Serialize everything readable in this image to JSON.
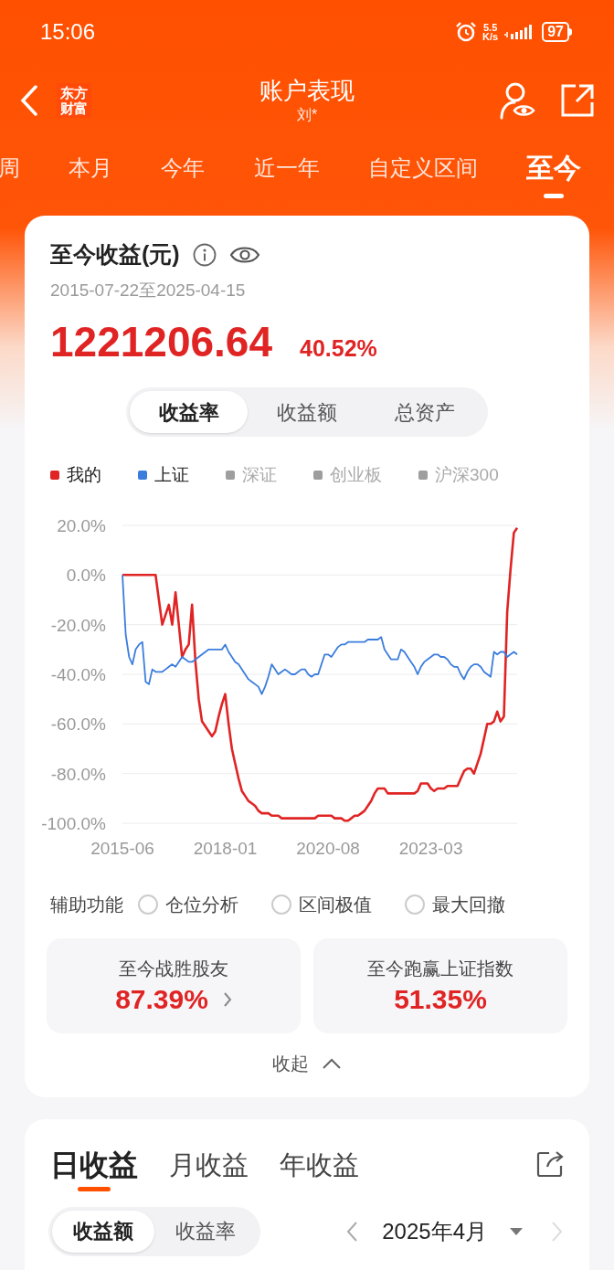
{
  "status_bar": {
    "time": "15:06",
    "net_speed": "5.5",
    "net_unit": "K/s",
    "battery": "97"
  },
  "header": {
    "logo": [
      "东方",
      "财富"
    ],
    "title": "账户表现",
    "subtitle": "刘*"
  },
  "period_tabs": [
    {
      "label": "周",
      "selected": false
    },
    {
      "label": "本月",
      "selected": false
    },
    {
      "label": "今年",
      "selected": false
    },
    {
      "label": "近一年",
      "selected": false
    },
    {
      "label": "自定义区间",
      "selected": false
    },
    {
      "label": "至今",
      "selected": true
    }
  ],
  "summary": {
    "title": "至今收益(元)",
    "date_range": "2015-07-22至2025-04-15",
    "amount": "1221206.64",
    "rate": "40.52%",
    "modes": [
      {
        "label": "收益率",
        "selected": true
      },
      {
        "label": "收益额",
        "selected": false
      },
      {
        "label": "总资产",
        "selected": false
      }
    ],
    "legend_others": [
      {
        "label": "深证",
        "selected": false
      },
      {
        "label": "创业板",
        "selected": false
      },
      {
        "label": "沪深300",
        "selected": false
      }
    ],
    "chart_data": {
      "type": "line",
      "categories": [
        "2015-06",
        null,
        null,
        null,
        null,
        null,
        null,
        null,
        null,
        null,
        null,
        null,
        null,
        null,
        null,
        null,
        null,
        null,
        null,
        null,
        null,
        null,
        null,
        null,
        null,
        null,
        null,
        null,
        null,
        null,
        null,
        "2018-01",
        null,
        null,
        null,
        null,
        null,
        null,
        null,
        null,
        null,
        null,
        null,
        null,
        null,
        null,
        null,
        null,
        null,
        null,
        null,
        null,
        null,
        null,
        null,
        null,
        null,
        null,
        null,
        null,
        null,
        null,
        "2020-08",
        null,
        null,
        null,
        null,
        null,
        null,
        null,
        null,
        null,
        null,
        null,
        null,
        null,
        null,
        null,
        null,
        null,
        null,
        null,
        null,
        null,
        null,
        null,
        null,
        null,
        null,
        null,
        null,
        null,
        null,
        "2023-03",
        null,
        null,
        null,
        null,
        null,
        null,
        null,
        null,
        null,
        null,
        null,
        null,
        null,
        null,
        null,
        null,
        null,
        null,
        null,
        null,
        null,
        null,
        null,
        null,
        null,
        null
      ],
      "grid": true,
      "series": [
        {
          "name": "我的",
          "color": "#e02424",
          "values": [
            0,
            0,
            0,
            0,
            0,
            0,
            0,
            0,
            0,
            0,
            0,
            -10,
            -20,
            -16,
            -12,
            -20,
            -7,
            -20,
            -33,
            -30,
            -28,
            -12,
            -35,
            -50,
            -59,
            -61,
            -63,
            -65,
            -63,
            -57,
            -52,
            -48,
            -60,
            -70,
            -76,
            -82,
            -87,
            -89,
            -91,
            -92,
            -93,
            -95,
            -96,
            -96,
            -96,
            -97,
            -97,
            -97,
            -98,
            -98,
            -98,
            -98,
            -98,
            -98,
            -98,
            -98,
            -98,
            -98,
            -98,
            -97,
            -97,
            -97,
            -97,
            -97,
            -98,
            -98,
            -98,
            -99,
            -99,
            -98,
            -97,
            -97,
            -96,
            -95,
            -93,
            -91,
            -88,
            -86,
            -86,
            -86,
            -88,
            -88,
            -88,
            -88,
            -88,
            -88,
            -88,
            -88,
            -88,
            -87,
            -84,
            -84,
            -84,
            -86,
            -87,
            -86,
            -86,
            -86,
            -85,
            -85,
            -85,
            -85,
            -82,
            -79,
            -78,
            -78,
            -80,
            -76,
            -72,
            -66,
            -60,
            -60,
            -59,
            -55,
            -59,
            -57,
            -15,
            2,
            17,
            19
          ]
        },
        {
          "name": "上证",
          "color": "#3b7ddd",
          "values": [
            0,
            -24,
            -33,
            -36,
            -30,
            -28,
            -27,
            -43,
            -44,
            -38,
            -39,
            -39,
            -39,
            -38,
            -37,
            -36,
            -37,
            -35,
            -33,
            -34,
            -35,
            -35,
            -34,
            -33,
            -32,
            -31,
            -30,
            -30,
            -30,
            -30,
            -30,
            -28,
            -31,
            -33,
            -35,
            -36,
            -38,
            -40,
            -42,
            -43,
            -44,
            -45,
            -48,
            -45,
            -41,
            -36,
            -38,
            -40,
            -39,
            -38,
            -39,
            -40,
            -40,
            -39,
            -38,
            -38,
            -40,
            -41,
            -40,
            -40,
            -36,
            -32,
            -32,
            -33,
            -31,
            -29,
            -28,
            -28,
            -27,
            -27,
            -27,
            -27,
            -27,
            -27,
            -26,
            -26,
            -26,
            -26,
            -25,
            -30,
            -32,
            -34,
            -34,
            -34,
            -30,
            -31,
            -33,
            -35,
            -37,
            -40,
            -37,
            -35,
            -34,
            -33,
            -32,
            -32,
            -33,
            -33,
            -34,
            -36,
            -37,
            -37,
            -40,
            -42,
            -39,
            -37,
            -36,
            -36,
            -37,
            -39,
            -40,
            -41,
            -31,
            -32,
            -31,
            -31,
            -33,
            -32,
            -31,
            -32
          ]
        }
      ],
      "ylim": [
        -100,
        20
      ],
      "yticks": [
        {
          "value": 20,
          "label": "20.0%"
        },
        {
          "value": 0,
          "label": "0.0%"
        },
        {
          "value": -20,
          "label": "-20.0%"
        },
        {
          "value": -40,
          "label": "-40.0%"
        },
        {
          "value": -60,
          "label": "-60.0%"
        },
        {
          "value": -80,
          "label": "-80.0%"
        },
        {
          "value": -100,
          "label": "-100.0%"
        }
      ]
    },
    "tools_label": "辅助功能",
    "tools": [
      {
        "label": "仓位分析",
        "checked": false
      },
      {
        "label": "区间极值",
        "checked": false
      },
      {
        "label": "最大回撤",
        "checked": false
      }
    ],
    "stats": [
      {
        "label": "至今战胜股友",
        "value": "87.39%",
        "link": true
      },
      {
        "label": "至今跑赢上证指数",
        "value": "51.35%",
        "link": false
      }
    ],
    "collapse": "收起"
  },
  "daily": {
    "tabs": [
      {
        "label": "日收益",
        "selected": true
      },
      {
        "label": "月收益",
        "selected": false
      },
      {
        "label": "年收益",
        "selected": false
      }
    ],
    "modes": [
      {
        "label": "收益额",
        "selected": true
      },
      {
        "label": "收益率",
        "selected": false
      }
    ],
    "month": "2025年4月",
    "next_disabled": true
  }
}
